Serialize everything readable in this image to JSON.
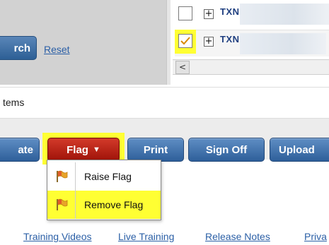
{
  "search_panel": {
    "search_button_label": "rch",
    "reset_link": "Reset"
  },
  "grid": {
    "rows": [
      {
        "id_prefix": "TXN(",
        "checked": false
      },
      {
        "id_prefix": "TXN(",
        "checked": true
      }
    ],
    "scroll_left_glyph": "<"
  },
  "items_bar": {
    "label": "tems"
  },
  "toolbar": {
    "create_label": "ate",
    "flag_label": "Flag",
    "flag_caret": "▼",
    "print_label": "Print",
    "signoff_label": "Sign Off",
    "upload_label": "Upload"
  },
  "flag_menu": {
    "items": [
      {
        "label": "Raise Flag",
        "icon": "flag-icon"
      },
      {
        "label": "Remove Flag",
        "icon": "flag-icon"
      }
    ]
  },
  "footer": {
    "links": [
      "Training Videos",
      "Live Training",
      "Release Notes",
      "Priva"
    ]
  },
  "colors": {
    "highlight": "#ffff33",
    "primary_button": "#2e5f9a",
    "flag_button": "#b8190c",
    "link": "#2b5fa6"
  }
}
